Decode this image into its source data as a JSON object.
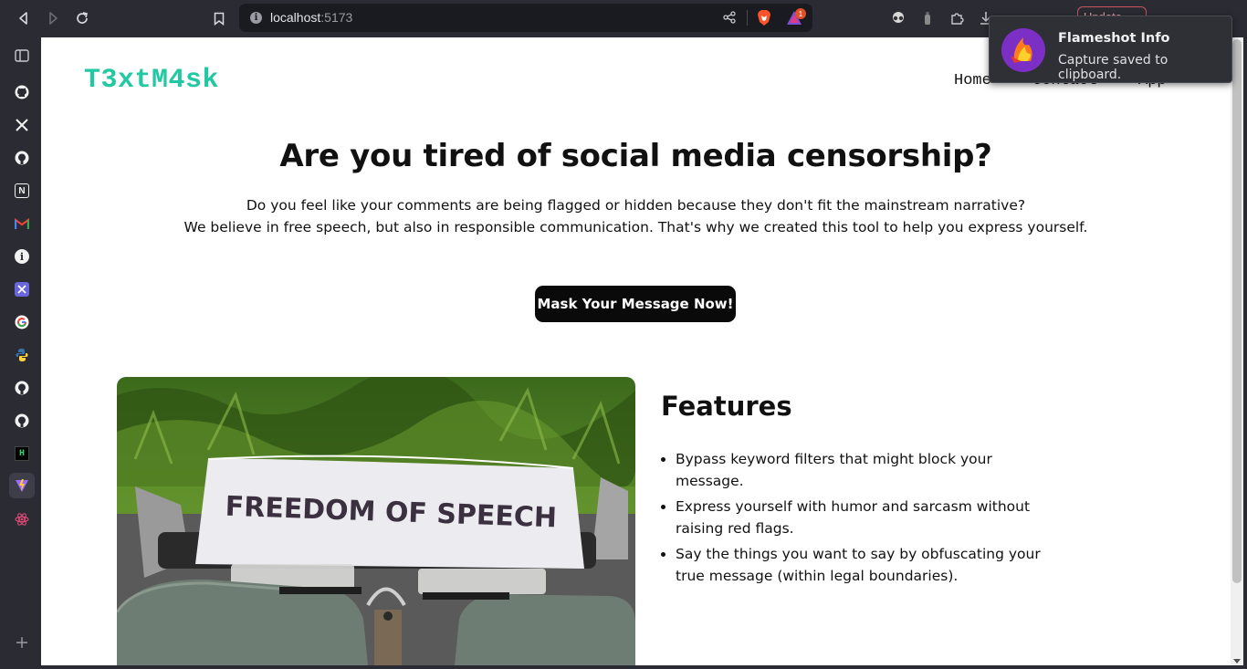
{
  "browser": {
    "url_host": "localhost",
    "url_port": ":5173",
    "update_label": "Update",
    "rewards_count": "1",
    "sidebar_items": [
      {
        "name": "sidebar-panel-icon"
      },
      {
        "name": "github-icon"
      },
      {
        "name": "x-twitter-icon"
      },
      {
        "name": "github-icon"
      },
      {
        "name": "notion-icon",
        "glyph": "N"
      },
      {
        "name": "gmail-icon"
      },
      {
        "name": "info-icon"
      },
      {
        "name": "excalidraw-icon"
      },
      {
        "name": "google-icon"
      },
      {
        "name": "python-icon"
      },
      {
        "name": "github-icon"
      },
      {
        "name": "github-icon"
      },
      {
        "name": "hackernoon-icon",
        "glyph": "H"
      },
      {
        "name": "vite-icon"
      },
      {
        "name": "react-icon"
      },
      {
        "name": "add-panel-icon"
      }
    ]
  },
  "page": {
    "logo": "T3xtM4sk",
    "nav": [
      "Home",
      "Contact",
      "App"
    ],
    "hero": {
      "title": "Are you tired of social media censorship?",
      "line1": "Do you feel like your comments are being flagged or hidden because they don't fit the mainstream narrative?",
      "line2": "We believe in free speech, but also in responsible communication. That's why we created this tool to help you express yourself."
    },
    "cta_label": "Mask Your Message Now!",
    "photo_text": "FREEDOM OF SPEECH",
    "features": {
      "title": "Features",
      "items": [
        "Bypass keyword filters that might block your message.",
        "Express yourself with humor and sarcasm without raising red flags.",
        "Say the things you want to say by obfuscating your true message (within legal boundaries)."
      ]
    }
  },
  "notification": {
    "title": "Flameshot Info",
    "body": "Capture saved to clipboard."
  },
  "colors": {
    "logo": "#22c8a2",
    "button_bg": "#0a0a0a",
    "chrome_bg": "#2b2c33"
  }
}
